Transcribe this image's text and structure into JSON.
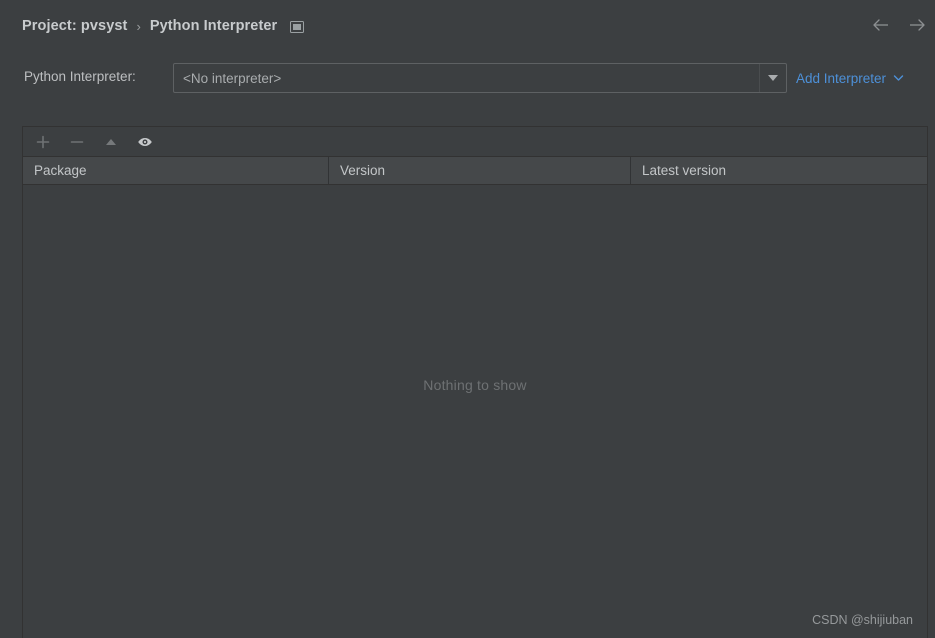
{
  "header": {
    "breadcrumb": {
      "project_crumb": "Project: pvsyst",
      "separator": "›",
      "page_crumb": "Python Interpreter",
      "icon": "window-screen-icon"
    },
    "nav": {
      "back_icon": "arrow-left-icon",
      "forward_icon": "arrow-right-icon"
    }
  },
  "interpreter": {
    "label": "Python Interpreter:",
    "selected_value": "<No interpreter>",
    "dropdown_icon": "triangle-down-icon",
    "add_interpreter_label": "Add Interpreter",
    "add_interpreter_chevron_icon": "chevron-down-icon",
    "link_color": "#4d90d8"
  },
  "packages": {
    "toolbar": [
      {
        "name": "add-package-button",
        "icon": "plus-icon",
        "enabled": false
      },
      {
        "name": "remove-package-button",
        "icon": "minus-icon",
        "enabled": false
      },
      {
        "name": "upgrade-package-button",
        "icon": "triangle-up-icon",
        "enabled": false
      },
      {
        "name": "show-early-releases-button",
        "icon": "eye-icon",
        "enabled": true
      }
    ],
    "columns": [
      "Package",
      "Version",
      "Latest version"
    ],
    "rows": [],
    "empty_message": "Nothing to show"
  },
  "watermark": "CSDN @shijiuban",
  "colors": {
    "page_background": "#3c3f41",
    "header_row_background": "#45484a",
    "border": "#323232",
    "text_primary": "#c8cbcd",
    "text_secondary": "#a9acae",
    "text_muted": "#6e7173",
    "accent_link": "#4d90d8"
  }
}
